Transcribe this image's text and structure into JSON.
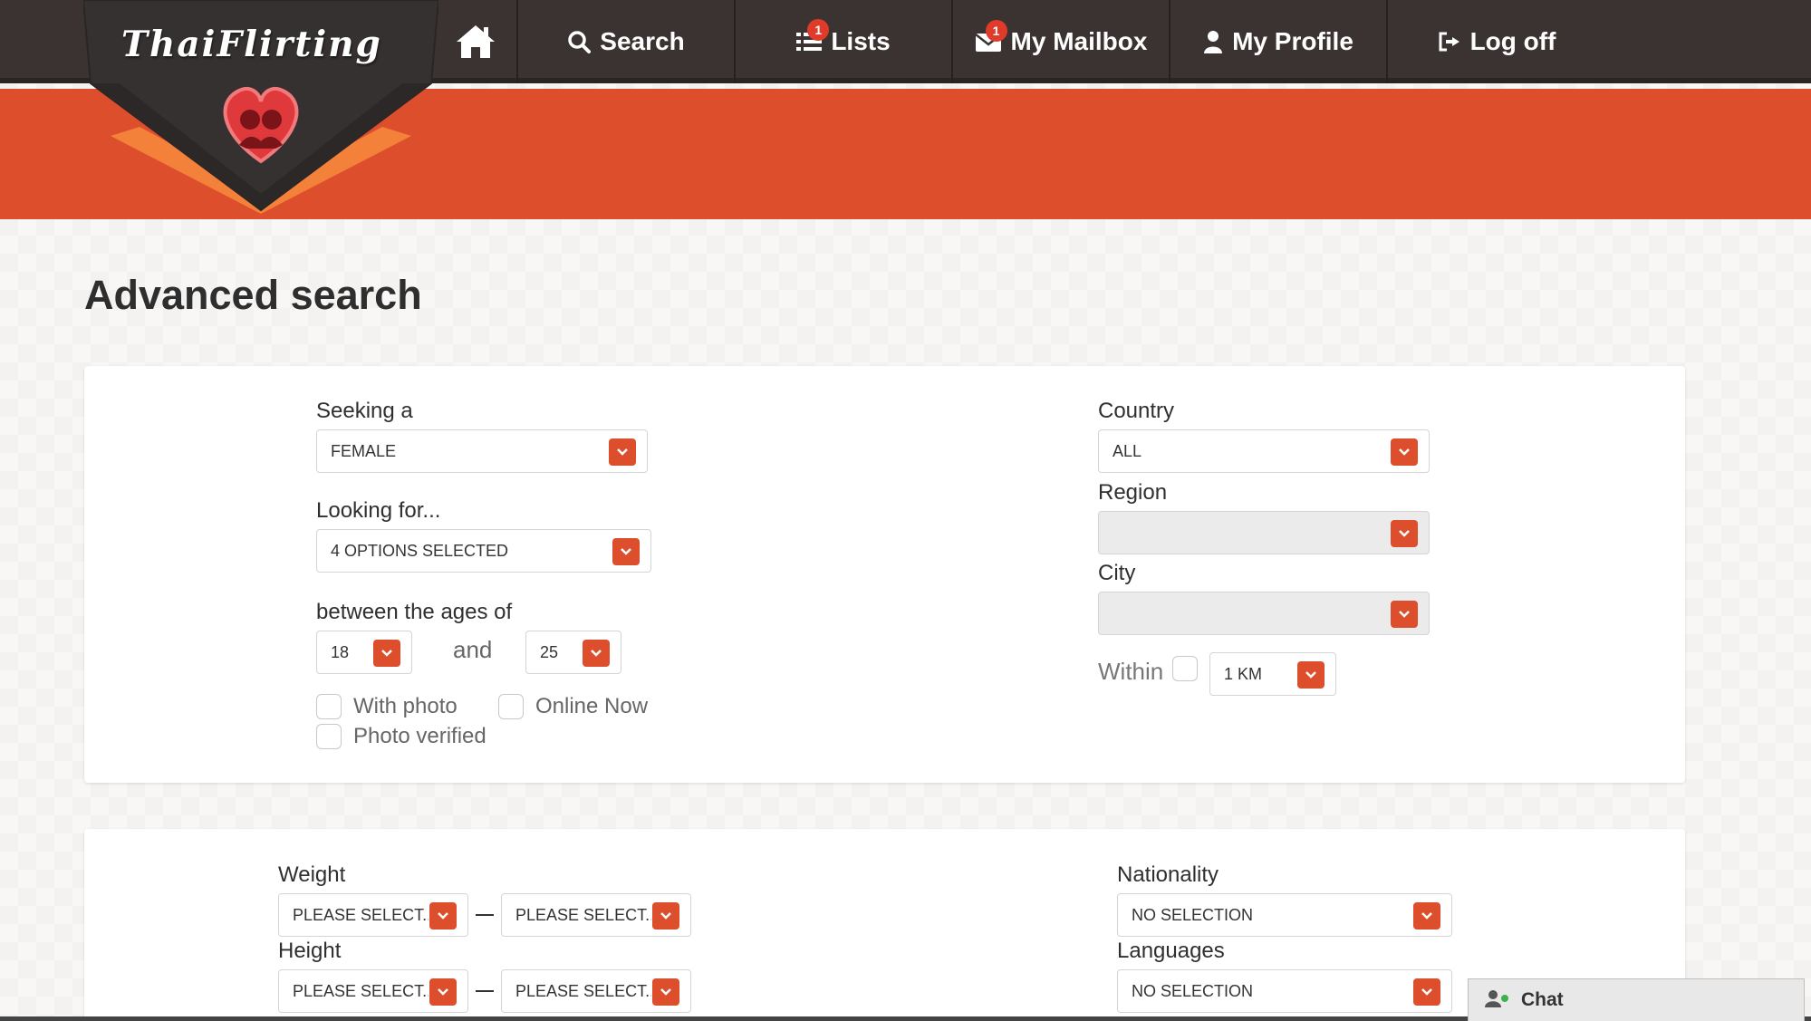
{
  "brand": {
    "logo_text": "ThaiFlirting"
  },
  "nav": {
    "home_icon": "home-icon",
    "search_label": "Search",
    "lists_label": "Lists",
    "lists_badge": "1",
    "mailbox_label": "My Mailbox",
    "mailbox_badge": "1",
    "profile_label": "My Profile",
    "logoff_label": "Log off"
  },
  "page": {
    "title": "Advanced search"
  },
  "basic": {
    "seeking_label": "Seeking a",
    "seeking_value": "FEMALE",
    "looking_label": "Looking for...",
    "looking_value": "4 OPTIONS SELECTED",
    "ages_label": "between the ages of",
    "age_min": "18",
    "and_label": "and",
    "age_max": "25",
    "with_photo_label": "With photo",
    "online_now_label": "Online Now",
    "photo_verified_label": "Photo verified",
    "country_label": "Country",
    "country_value": "ALL",
    "region_label": "Region",
    "region_value": "",
    "city_label": "City",
    "city_value": "",
    "within_label": "Within",
    "within_value": "1 KM"
  },
  "physical": {
    "weight_label": "Weight",
    "weight_min": "PLEASE SELECT...",
    "weight_max": "PLEASE SELECT...",
    "height_label": "Height",
    "height_min": "PLEASE SELECT...",
    "height_max": "PLEASE SELECT...",
    "nationality_label": "Nationality",
    "nationality_value": "NO SELECTION",
    "languages_label": "Languages",
    "languages_value": "NO SELECTION"
  },
  "chat": {
    "label": "Chat"
  },
  "colors": {
    "accent": "#dc4e2c",
    "nav_bg": "#3a3331"
  }
}
